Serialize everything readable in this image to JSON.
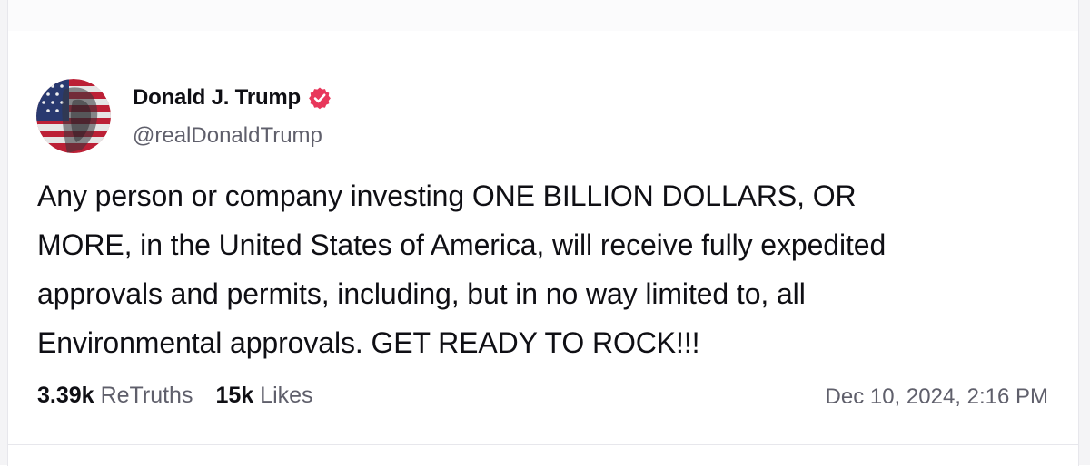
{
  "post": {
    "author": {
      "display_name": "Donald J. Trump",
      "handle": "@realDonaldTrump",
      "verified": true,
      "verified_color": "#e8375b"
    },
    "body_lines": [
      "Any person or company investing ONE BILLION DOLLARS, OR",
      "MORE, in the United States of America, will receive fully expedited",
      "approvals and permits, including, but in no way limited to, all",
      "Environmental approvals. GET READY TO ROCK!!!"
    ],
    "stats": {
      "retruths_count": "3.39k",
      "retruths_label": "ReTruths",
      "likes_count": "15k",
      "likes_label": "Likes"
    },
    "timestamp": "Dec 10, 2024, 2:16 PM"
  },
  "icons": {
    "verified": "verified-badge-icon",
    "avatar": "profile-avatar"
  }
}
